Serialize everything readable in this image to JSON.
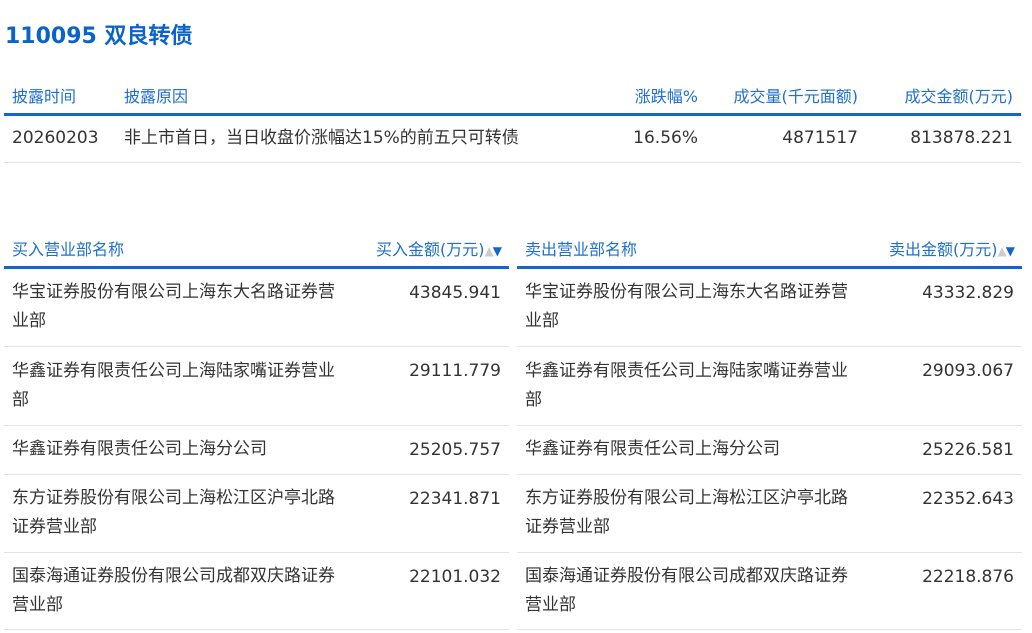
{
  "title": "110095 双良转债",
  "summary": {
    "headers": [
      "披露时间",
      "披露原因",
      "涨跌幅%",
      "成交量(千元面额)",
      "成交金额(万元)"
    ],
    "row": [
      "20260203",
      "非上市首日，当日收盘价涨幅达15%的前五只可转债",
      "16.56%",
      "4871517",
      "813878.221"
    ]
  },
  "buy": {
    "headers": [
      "买入营业部名称",
      "买入金额(万元)"
    ],
    "rows": [
      [
        "华宝证券股份有限公司上海东大名路证券营业部",
        "43845.941"
      ],
      [
        "华鑫证券有限责任公司上海陆家嘴证券营业部",
        "29111.779"
      ],
      [
        "华鑫证券有限责任公司上海分公司",
        "25205.757"
      ],
      [
        "东方证券股份有限公司上海松江区沪亭北路证券营业部",
        "22341.871"
      ],
      [
        "国泰海通证券股份有限公司成都双庆路证券营业部",
        "22101.032"
      ]
    ]
  },
  "sell": {
    "headers": [
      "卖出营业部名称",
      "卖出金额(万元)"
    ],
    "rows": [
      [
        "华宝证券股份有限公司上海东大名路证券营业部",
        "43332.829"
      ],
      [
        "华鑫证券有限责任公司上海陆家嘴证券营业部",
        "29093.067"
      ],
      [
        "华鑫证券有限责任公司上海分公司",
        "25226.581"
      ],
      [
        "东方证券股份有限公司上海松江区沪亭北路证券营业部",
        "22352.643"
      ],
      [
        "国泰海通证券股份有限公司成都双庆路证券营业部",
        "22218.876"
      ]
    ]
  },
  "sort_icons": {
    "up": "▲",
    "down": "▼"
  }
}
